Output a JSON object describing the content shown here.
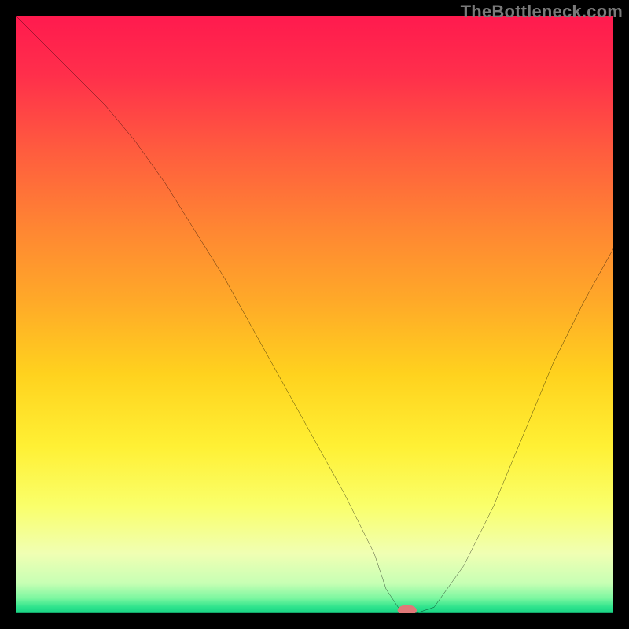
{
  "watermark": "TheBottleneck.com",
  "chart_data": {
    "type": "line",
    "title": "",
    "xlabel": "",
    "ylabel": "",
    "xlim": [
      0,
      100
    ],
    "ylim": [
      0,
      100
    ],
    "grid": false,
    "legend": false,
    "background_gradient": {
      "stops": [
        {
          "offset": 0.0,
          "color": "#ff1a4e"
        },
        {
          "offset": 0.1,
          "color": "#ff2f4b"
        },
        {
          "offset": 0.22,
          "color": "#ff5a3f"
        },
        {
          "offset": 0.35,
          "color": "#ff8433"
        },
        {
          "offset": 0.48,
          "color": "#ffaa28"
        },
        {
          "offset": 0.6,
          "color": "#ffd21e"
        },
        {
          "offset": 0.72,
          "color": "#fff034"
        },
        {
          "offset": 0.82,
          "color": "#faff6a"
        },
        {
          "offset": 0.9,
          "color": "#f0ffb3"
        },
        {
          "offset": 0.95,
          "color": "#c7ffb4"
        },
        {
          "offset": 0.975,
          "color": "#7bf7a0"
        },
        {
          "offset": 0.99,
          "color": "#2de38c"
        },
        {
          "offset": 1.0,
          "color": "#18d184"
        }
      ]
    },
    "series": [
      {
        "name": "bottleneck-curve",
        "color": "#000000",
        "width": 2,
        "x": [
          0,
          5,
          10,
          15,
          20,
          25,
          30,
          35,
          40,
          45,
          50,
          55,
          60,
          62,
          64,
          67,
          70,
          75,
          80,
          85,
          90,
          95,
          100
        ],
        "y": [
          100,
          95,
          90,
          85,
          79,
          72,
          64,
          56,
          47,
          38,
          29,
          20,
          10,
          4,
          1,
          0,
          1,
          8,
          18,
          30,
          42,
          52,
          61
        ]
      }
    ],
    "marker": {
      "name": "optimal-marker",
      "x": 65.5,
      "y": 0.5,
      "rx": 1.6,
      "ry": 0.9,
      "color": "#e07878"
    }
  }
}
